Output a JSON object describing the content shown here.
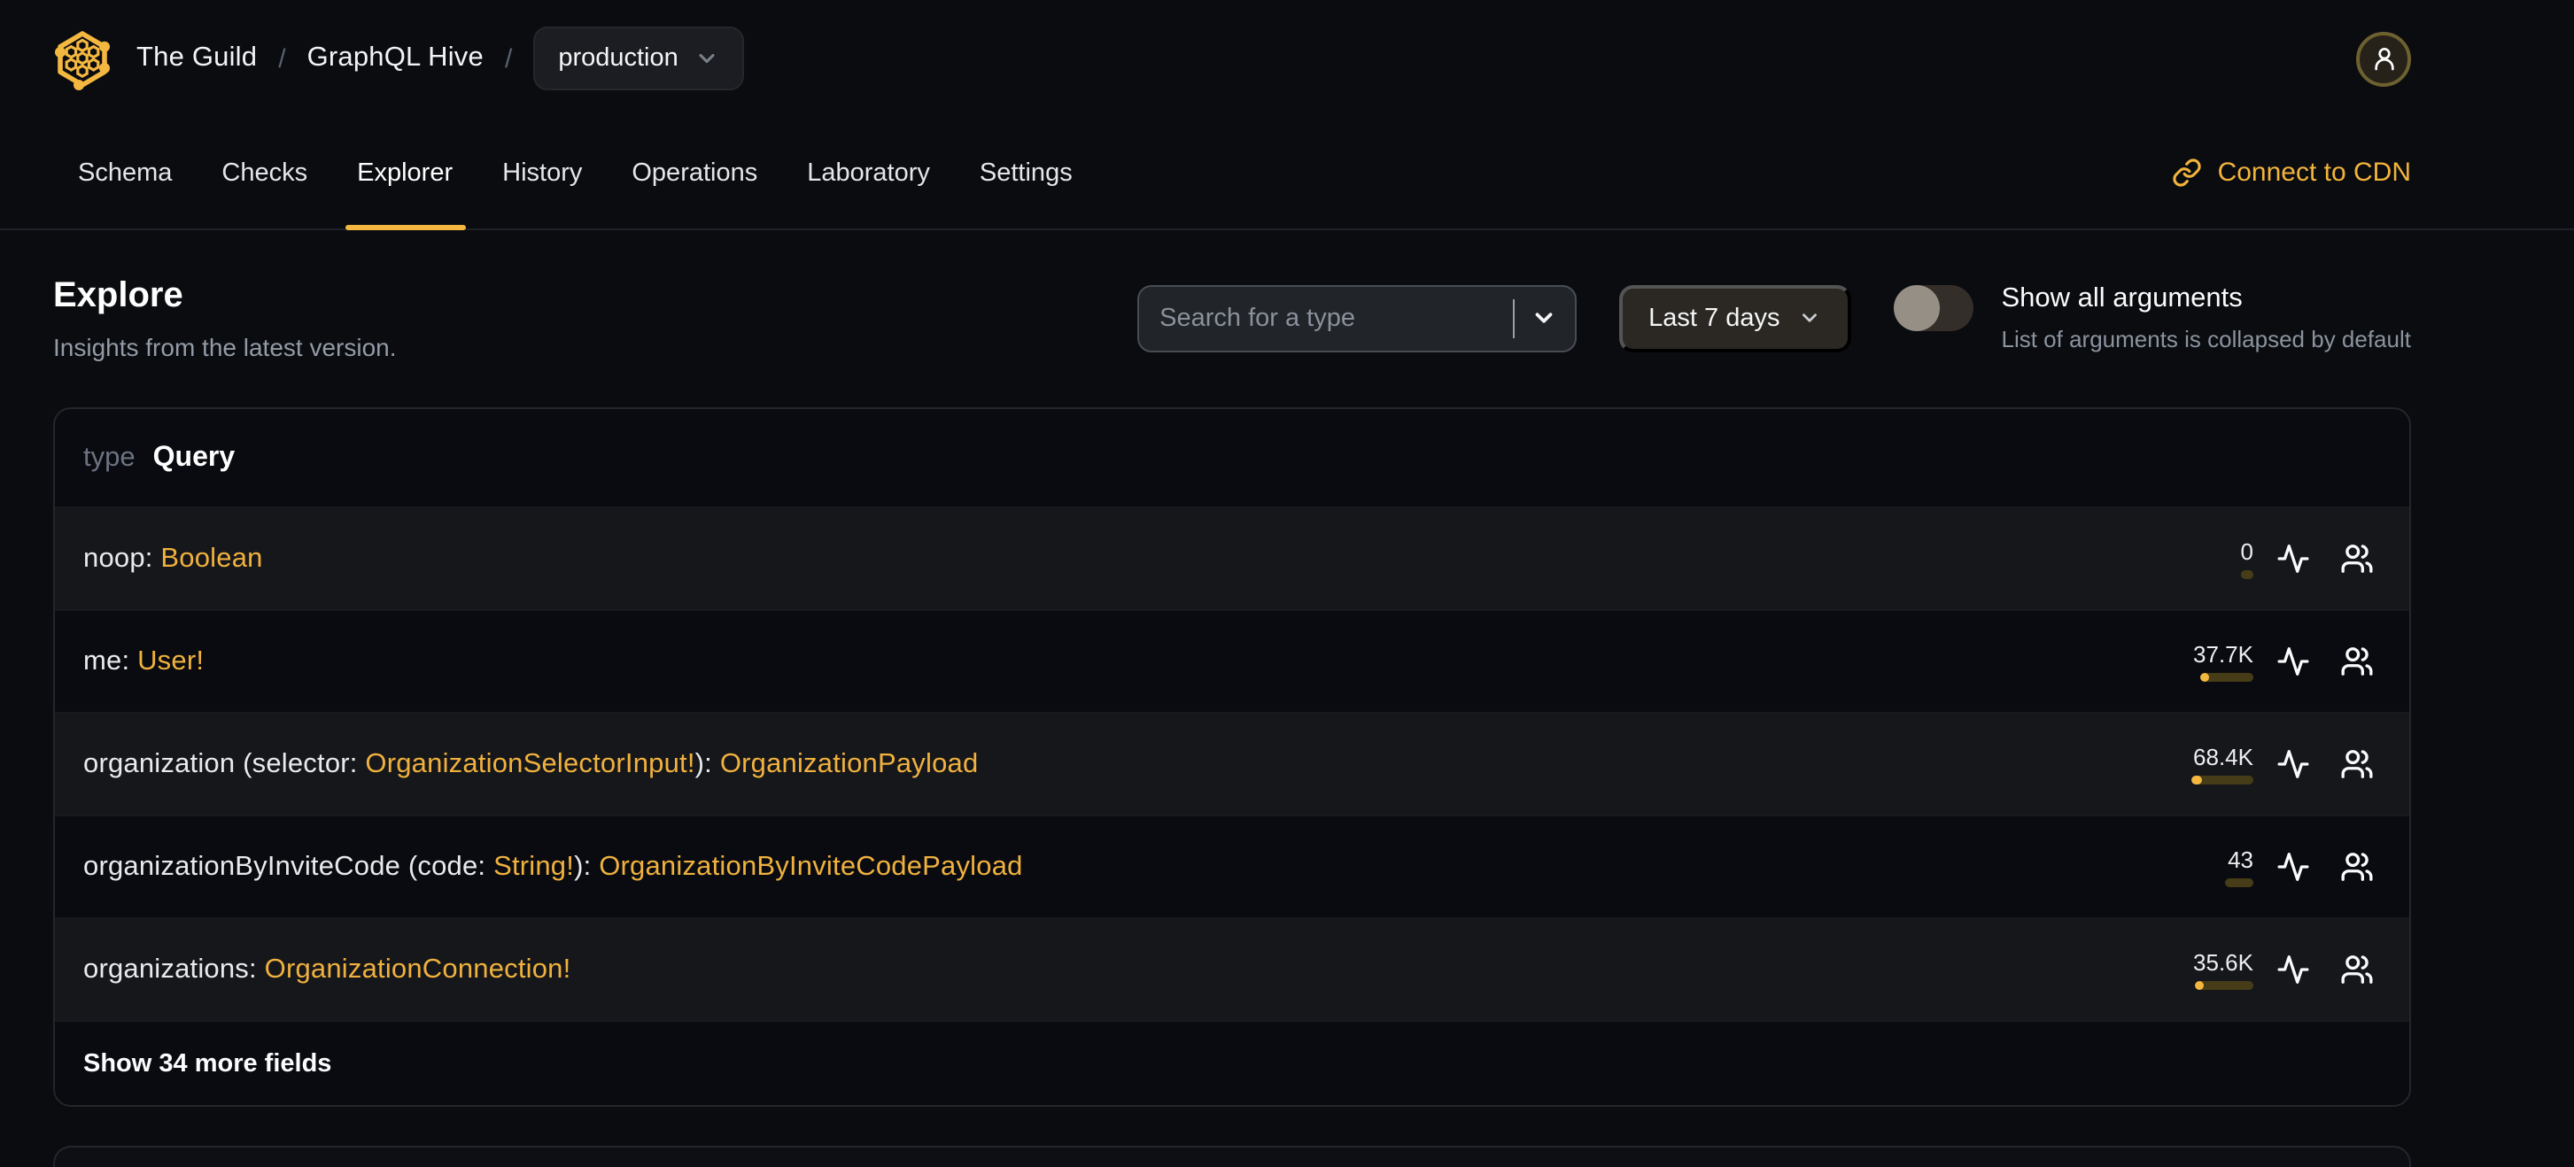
{
  "brand": {
    "org": "The Guild",
    "project": "GraphQL Hive",
    "target": "production",
    "separator": "/"
  },
  "colors": {
    "accent": "#f4b740",
    "type_link": "#f0b13e",
    "bar_track": "#473c18",
    "bar_fill": "#f4b740",
    "page_bg": "#0a0c10"
  },
  "icons": {
    "logo": "hive-honeycomb-logo",
    "avatar": "user-icon",
    "target_chevron": "chevron-down-icon",
    "cdn": "link-icon",
    "search_chevron": "chevron-down-icon",
    "period_chevron": "chevron-down-icon",
    "row_stats": "activity-icon",
    "row_clients": "users-icon"
  },
  "nav": {
    "tabs": [
      {
        "id": "schema",
        "label": "Schema",
        "active": false
      },
      {
        "id": "checks",
        "label": "Checks",
        "active": false
      },
      {
        "id": "explorer",
        "label": "Explorer",
        "active": true
      },
      {
        "id": "history",
        "label": "History",
        "active": false
      },
      {
        "id": "operations",
        "label": "Operations",
        "active": false
      },
      {
        "id": "laboratory",
        "label": "Laboratory",
        "active": false
      },
      {
        "id": "settings",
        "label": "Settings",
        "active": false
      }
    ],
    "cdn_label": "Connect to CDN"
  },
  "page": {
    "title": "Explore",
    "subtitle": "Insights from the latest version."
  },
  "controls": {
    "search_placeholder": "Search for a type",
    "search_value": "",
    "period": "Last 7 days",
    "toggle_label": "Show all arguments",
    "toggle_desc": "List of arguments is collapsed by default",
    "toggle_on": false
  },
  "type_card": {
    "kind_label": "type",
    "name": "Query",
    "show_more": "Show 34 more fields",
    "fields": [
      {
        "segments": [
          {
            "text": "noop: ",
            "kind": "plain"
          },
          {
            "text": "Boolean",
            "kind": "type"
          }
        ],
        "count": "0",
        "bar_track": 7,
        "bar_fill": 0
      },
      {
        "segments": [
          {
            "text": "me: ",
            "kind": "plain"
          },
          {
            "text": "User!",
            "kind": "type"
          }
        ],
        "count": "37.7K",
        "bar_track": 30,
        "bar_fill": 5
      },
      {
        "segments": [
          {
            "text": "organization (selector: ",
            "kind": "plain"
          },
          {
            "text": "OrganizationSelectorInput!",
            "kind": "type"
          },
          {
            "text": "): ",
            "kind": "plain"
          },
          {
            "text": "OrganizationPayload",
            "kind": "type"
          }
        ],
        "count": "68.4K",
        "bar_track": 35,
        "bar_fill": 6
      },
      {
        "segments": [
          {
            "text": "organizationByInviteCode (code: ",
            "kind": "plain"
          },
          {
            "text": "String!",
            "kind": "type"
          },
          {
            "text": "): ",
            "kind": "plain"
          },
          {
            "text": "OrganizationByInviteCodePayload",
            "kind": "type"
          }
        ],
        "count": "43",
        "bar_track": 16,
        "bar_fill": 0
      },
      {
        "segments": [
          {
            "text": "organizations: ",
            "kind": "plain"
          },
          {
            "text": "OrganizationConnection!",
            "kind": "type"
          }
        ],
        "count": "35.6K",
        "bar_track": 33,
        "bar_fill": 5
      }
    ]
  }
}
